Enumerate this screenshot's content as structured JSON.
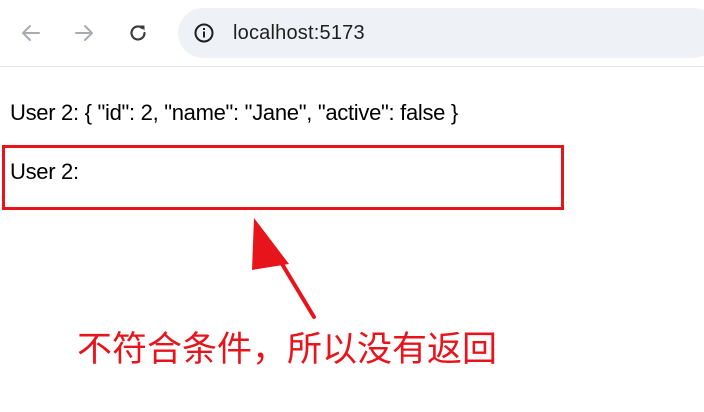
{
  "browser": {
    "url": "localhost:5173",
    "icons": {
      "back": "arrow-left-icon",
      "forward": "arrow-right-icon",
      "reload": "reload-icon",
      "site_info": "info-icon"
    }
  },
  "content": {
    "line1": "User 2: { \"id\": 2, \"name\": \"Jane\", \"active\": false }",
    "line2": "User 2:"
  },
  "annotation": {
    "text": "不符合条件，所以没有返回",
    "color": "#e8141c"
  },
  "colors": {
    "highlight_border": "#e8141c",
    "address_bar_bg": "#eef1f6"
  }
}
